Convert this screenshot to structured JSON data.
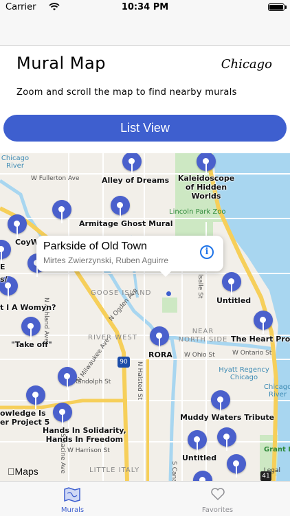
{
  "status_bar": {
    "carrier": "Carrier",
    "time": "10:34 PM"
  },
  "header": {
    "title": "Mural Map",
    "city": "Chicago",
    "subtitle": "Zoom and scroll the map to find nearby murals",
    "list_button": "List View"
  },
  "callout": {
    "title": "Parkside of Old Town",
    "artists": "Mirtes Zwierzynski, Ruben Aguirre",
    "info_icon": "info-icon"
  },
  "pins": [
    {
      "label": "Alley of Dreams"
    },
    {
      "label": "Kaleidoscope of Hidden Worlds"
    },
    {
      "label": "Armitage Ghost Mural"
    },
    {
      "label": "CoyW"
    },
    {
      "label": "E"
    },
    {
      "label": "s/"
    },
    {
      "label": "t I A Womyn?"
    },
    {
      "label": "\"Take off\""
    },
    {
      "label": "Untitled"
    },
    {
      "label": "The Heart Proje"
    },
    {
      "label": "RORA"
    },
    {
      "label": "owledge Is\ner Project 5"
    },
    {
      "label": "Hands In Solidarity,\nHands In Freedom"
    },
    {
      "label": "Muddy Waters Tribute"
    },
    {
      "label": "Untitled"
    }
  ],
  "map_labels": {
    "areas": [
      "GOOSE ISLAND",
      "RIVER WEST",
      "NEAR NORTH SIDE",
      "LITTLE ITALY"
    ],
    "streets": [
      "W Fullerton Ave",
      "N Ashland Ave",
      "W Ohio St",
      "W Randolph St",
      "W Harrison St",
      "N Halsted St",
      "N Milwaukee Ave",
      "W Ontario St",
      "S Canal",
      "lsalle St",
      "S Racine Ave",
      "N Ogden Ave"
    ],
    "parks": [
      "Lincoln Park Zoo",
      "Grant Pa"
    ],
    "water": [
      "Chicago River",
      "Chicago River"
    ],
    "hotel": "Hyatt Regency Chicago",
    "highway_shields": [
      "90",
      "41"
    ],
    "maps_logo": "Maps",
    "legal": "Legal"
  },
  "tabs": [
    {
      "label": "Murals",
      "icon": "map-icon",
      "selected": true
    },
    {
      "label": "Favorites",
      "icon": "heart-icon",
      "selected": false
    }
  ],
  "colors": {
    "accent": "#3e5fcf",
    "pin": "#4a60cc",
    "water": "#a8d6f0",
    "park": "#cde8c3",
    "highway": "#f6cf5a"
  }
}
